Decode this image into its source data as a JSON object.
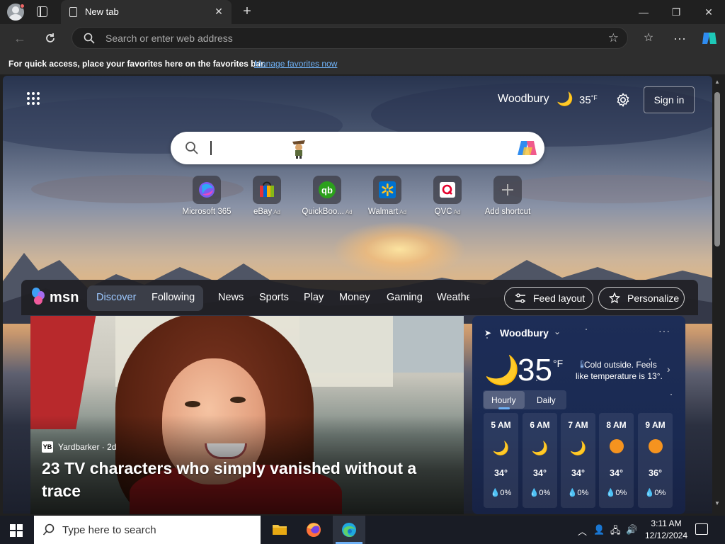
{
  "browser": {
    "tab_title": "New tab",
    "new_tab_symbol": "+",
    "address_placeholder": "Search or enter web address"
  },
  "favbar": {
    "text": "For quick access, place your favorites here on the favorites bar.",
    "link": "Manage favorites now"
  },
  "header": {
    "location": "Woodbury",
    "temp": "35",
    "unit": "°F",
    "signin": "Sign in"
  },
  "shortcuts": [
    {
      "label": "Microsoft 365",
      "ad": ""
    },
    {
      "label": "eBay",
      "ad": "Ad"
    },
    {
      "label": "QuickBoo...",
      "ad": "Ad"
    },
    {
      "label": "Walmart",
      "ad": "Ad"
    },
    {
      "label": "QVC",
      "ad": "Ad"
    },
    {
      "label": "Add shortcut",
      "ad": ""
    }
  ],
  "feed": {
    "brand": "msn",
    "tabs": [
      "Discover",
      "Following"
    ],
    "nav": [
      "News",
      "Sports",
      "Play",
      "Money",
      "Gaming",
      "Weathe"
    ],
    "feed_layout": "Feed layout",
    "personalize": "Personalize"
  },
  "article": {
    "source_logo": "YB",
    "source": "Yardbarker · 2d",
    "headline": "23 TV characters who simply vanished without a trace"
  },
  "weather": {
    "location": "Woodbury",
    "temp": "35",
    "unit": "°F",
    "description": "Cold outside. Feels like temperature is 13°.",
    "tabs": [
      "Hourly",
      "Daily"
    ],
    "hours": [
      {
        "time": "5 AM",
        "icon": "moon",
        "temp": "34°",
        "precip": "0%"
      },
      {
        "time": "6 AM",
        "icon": "moon",
        "temp": "34°",
        "precip": "0%"
      },
      {
        "time": "7 AM",
        "icon": "moon",
        "temp": "34°",
        "precip": "0%"
      },
      {
        "time": "8 AM",
        "icon": "sun",
        "temp": "34°",
        "precip": "0%"
      },
      {
        "time": "9 AM",
        "icon": "sun",
        "temp": "36°",
        "precip": "0%"
      }
    ]
  },
  "taskbar": {
    "search_placeholder": "Type here to search",
    "time": "3:11 AM",
    "date": "12/12/2024"
  }
}
